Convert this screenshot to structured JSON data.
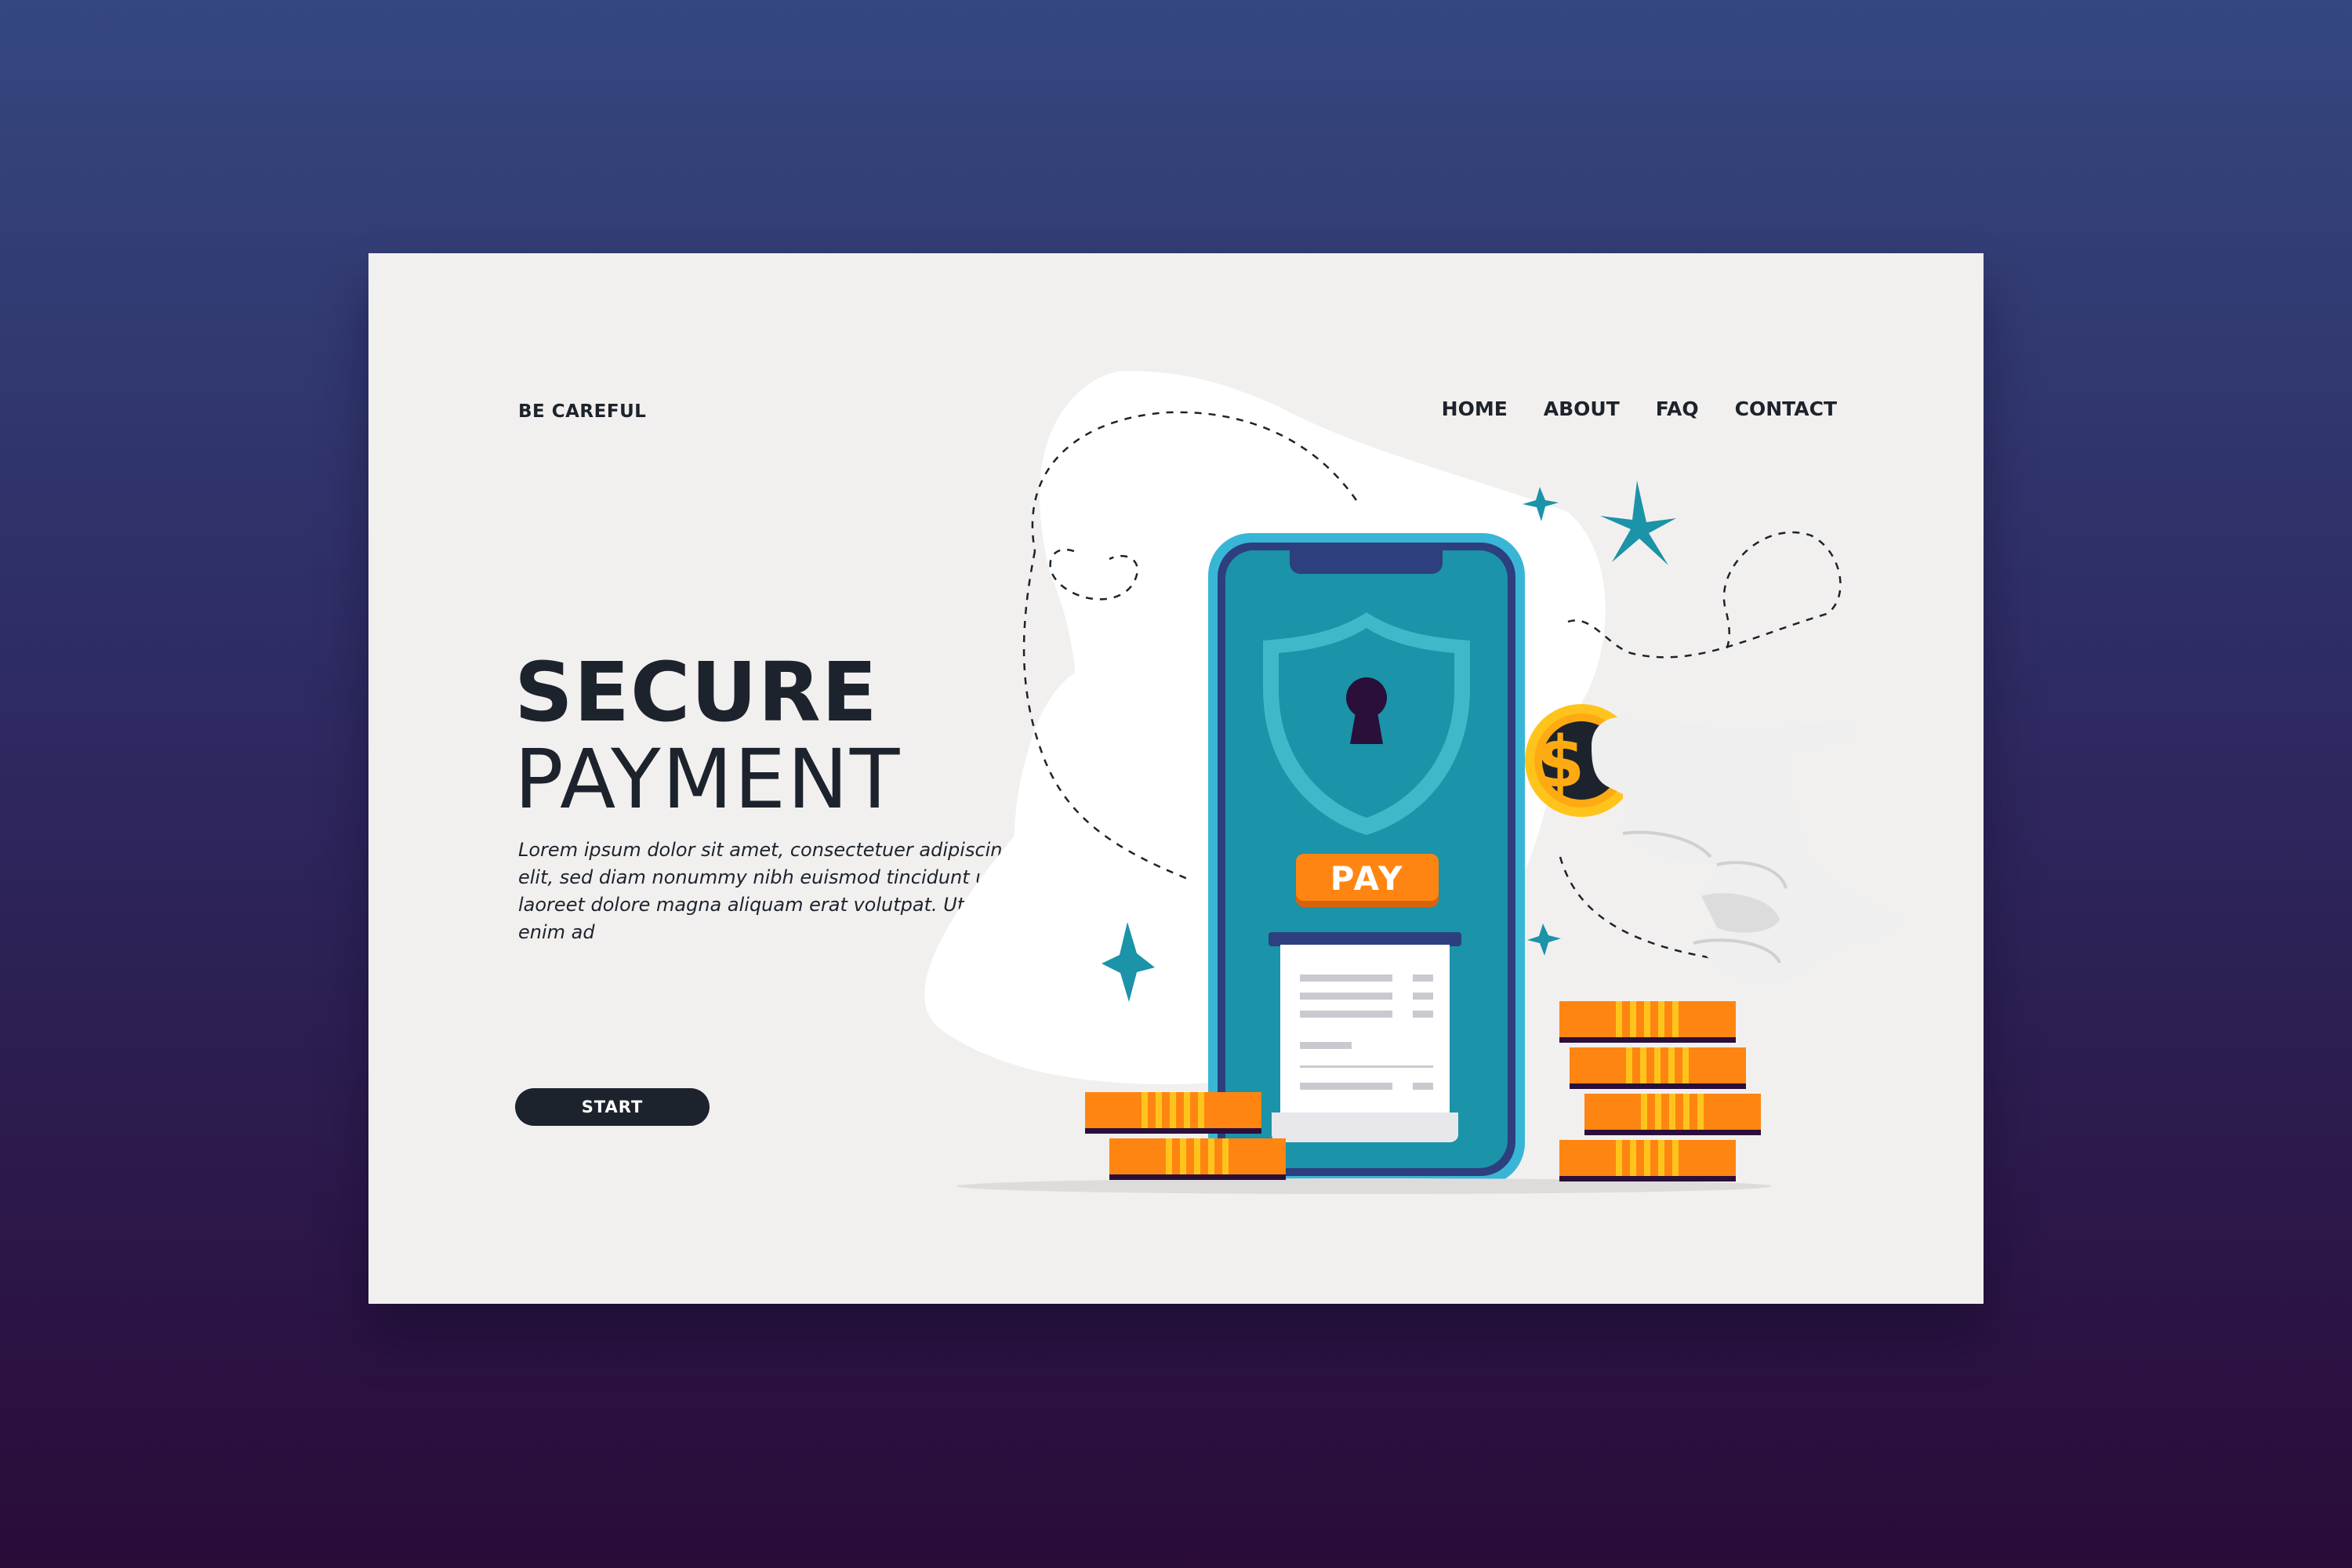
{
  "header": {
    "brand": "BE CAREFUL",
    "nav": [
      "HOME",
      "ABOUT",
      "FAQ",
      "CONTACT"
    ]
  },
  "hero": {
    "title": "SECURE",
    "subtitle": "PAYMENT",
    "body": "Lorem ipsum dolor sit amet, consectetuer adipiscing elit, sed diam nonummy nibh euismod tincidunt ut laoreet dolore magna aliquam erat volutpat. Ut wisi enim ad",
    "cta": "START"
  },
  "illustration": {
    "pay_label": "PAY",
    "coin_symbol": "$",
    "icons": [
      "smartphone-icon",
      "shield-icon",
      "keyhole-icon",
      "receipt-icon",
      "coin-icon",
      "hand-icon",
      "sparkle-icon"
    ]
  },
  "colors": {
    "page_background_top": "#35477f",
    "page_background_bottom": "#2a0b38",
    "card_background": "#f2f0ef",
    "text_dark": "#1d232c",
    "phone_teal": "#1b93a8",
    "phone_navy": "#2d3f7e",
    "phone_frame": "#39b6d6",
    "accent_orange": "#ff8512",
    "coin_gold": "#ffc41c"
  }
}
